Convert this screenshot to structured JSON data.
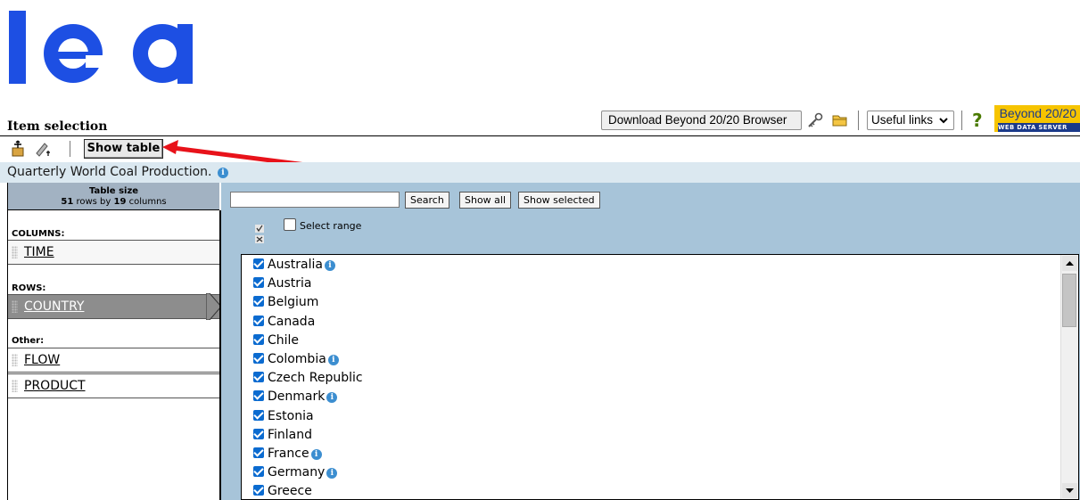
{
  "logo_text": "iea",
  "page_title": "Item selection",
  "header_toolbar": {
    "download_label": "Download Beyond 20/20 Browser",
    "useful_links_label": "Useful links",
    "help_symbol": "?",
    "brand_line1": "Beyond 20/20",
    "brand_line2": "WEB DATA SERVER",
    "icons": [
      "key-icon",
      "folder-icon",
      "help-icon",
      "chevron-down-icon"
    ]
  },
  "toolbar": {
    "show_table_label": "Show table",
    "icons": [
      "pivot-icon",
      "edit-dimension-icon"
    ]
  },
  "caption": "Quarterly World Coal Production.",
  "table_size": {
    "heading": "Table size",
    "rows": "51",
    "rows_text": " rows by ",
    "cols": "19",
    "cols_text": " columns"
  },
  "dimensions": {
    "columns_label": "COLUMNS:",
    "columns": [
      "TIME"
    ],
    "rows_label": "ROWS:",
    "rows": [
      "COUNTRY"
    ],
    "other_label": "Other:",
    "other": [
      "FLOW",
      "PRODUCT"
    ]
  },
  "search": {
    "value": "",
    "search_label": "Search",
    "show_all_label": "Show all",
    "show_selected_label": "Show selected",
    "select_range_label": "Select range"
  },
  "items": [
    {
      "label": "Australia",
      "info": true
    },
    {
      "label": "Austria",
      "info": false
    },
    {
      "label": "Belgium",
      "info": false
    },
    {
      "label": "Canada",
      "info": false
    },
    {
      "label": "Chile",
      "info": false
    },
    {
      "label": "Colombia",
      "info": true
    },
    {
      "label": "Czech Republic",
      "info": false
    },
    {
      "label": "Denmark",
      "info": true
    },
    {
      "label": "Estonia",
      "info": false
    },
    {
      "label": "Finland",
      "info": false
    },
    {
      "label": "France",
      "info": true
    },
    {
      "label": "Germany",
      "info": true
    },
    {
      "label": "Greece",
      "info": false
    }
  ],
  "colors": {
    "iea_blue": "#1d4fe3",
    "caption_bg": "#dbe8f0",
    "panel_blue": "#a7c4d9",
    "check_blue": "#0b6bd0",
    "arrow_red": "#e8121a"
  }
}
